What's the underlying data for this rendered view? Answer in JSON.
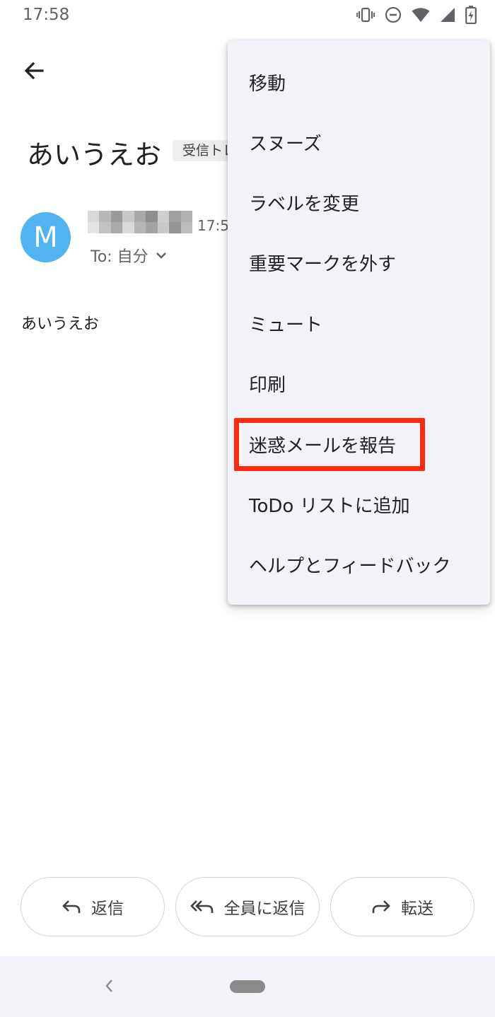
{
  "status_bar": {
    "time": "17:58",
    "icons": [
      "vibrate-icon",
      "do-not-disturb-icon",
      "wifi-icon",
      "cell-signal-icon",
      "battery-charging-icon"
    ]
  },
  "app_bar": {
    "back_icon": "arrow-back-icon"
  },
  "email": {
    "subject": "あいうえお",
    "label": "受信トレイ",
    "avatar_letter": "M",
    "avatar_color": "#4fb4ef",
    "time": "17:58",
    "to": "To: 自分",
    "body": "あいうえお"
  },
  "menu": {
    "items": [
      "移動",
      "スヌーズ",
      "ラベルを変更",
      "重要マークを外す",
      "ミュート",
      "印刷",
      "迷惑メールを報告",
      "ToDo リストに追加",
      "ヘルプとフィードバック"
    ],
    "highlighted_item": "迷惑メールを報告",
    "highlight_color": "#ff2a12"
  },
  "actions": {
    "reply": "返信",
    "reply_all": "全員に返信",
    "forward": "転送"
  },
  "colors": {
    "menu_bg": "#f1f3f9",
    "nav_bg": "#f1f3f9"
  }
}
